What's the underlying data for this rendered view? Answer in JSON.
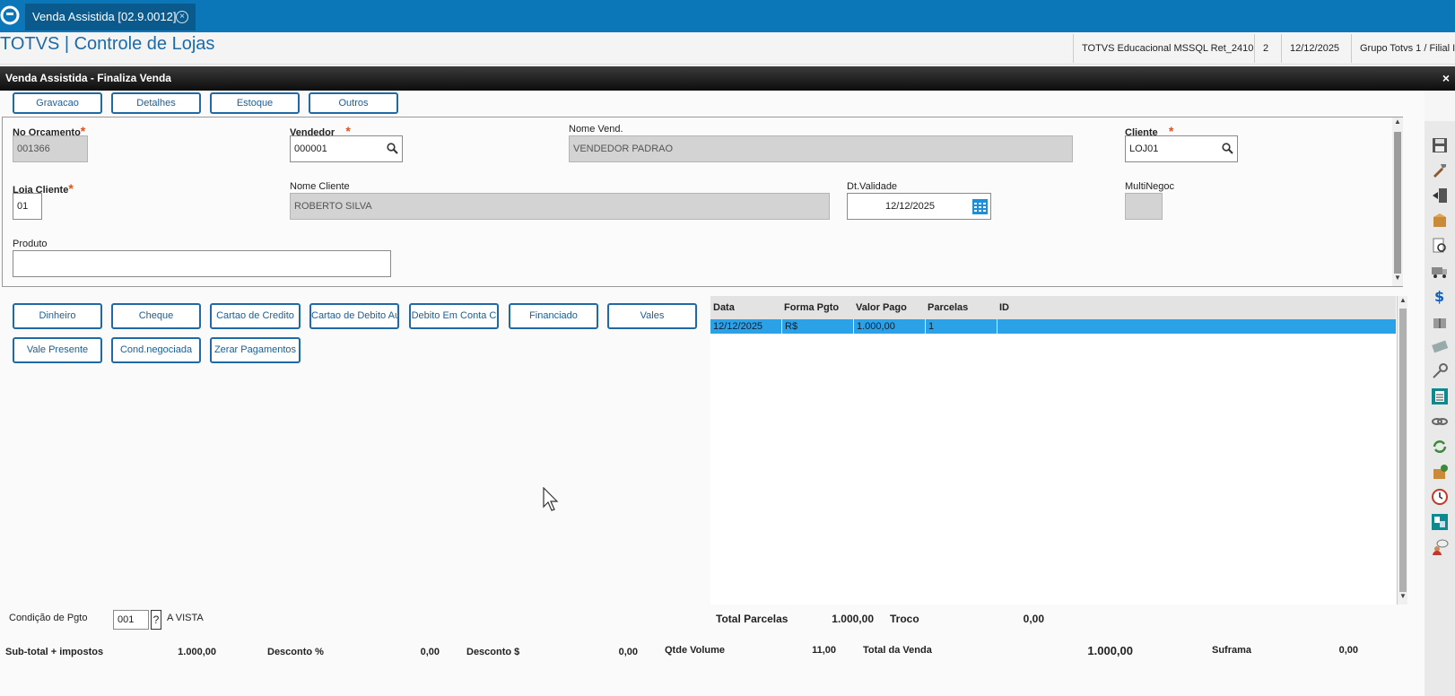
{
  "tab": {
    "title": "Venda Assistida [02.9.0012]"
  },
  "header": {
    "app_title": "TOTVS | Controle de Lojas",
    "environment": "TOTVS Educacional MSSQL Ret_2410",
    "module_number": "2",
    "date": "12/12/2025",
    "company": "Grupo Totvs 1 / Filial I"
  },
  "dialog": {
    "title": "Venda Assistida - Finaliza Venda",
    "close_label": "×"
  },
  "toolbar": [
    "Gravacao",
    "Detalhes",
    "Estoque",
    "Outros"
  ],
  "form": {
    "orcamento_label": "No Orcamento",
    "orcamento_value": "001366",
    "vendedor_label": "Vendedor",
    "vendedor_value": "000001",
    "nome_vend_label": "Nome Vend.",
    "nome_vend_value": "VENDEDOR PADRAO",
    "cliente_label": "Cliente",
    "cliente_value": "LOJ01",
    "loja_cliente_label": "Loja Cliente",
    "loja_cliente_value": "01",
    "nome_cliente_label": "Nome Cliente",
    "nome_cliente_value": "ROBERTO SILVA",
    "dt_validade_label": "Dt.Validade",
    "dt_validade_value": "12/12/2025",
    "multinegoc_label": "MultiNegoc",
    "multinegoc_value": "",
    "produto_label": "Produto",
    "produto_value": "",
    "required_mark": "*"
  },
  "payment_buttons": [
    "Dinheiro",
    "Cheque",
    "Cartao de Credito",
    "Cartao de Debito Au",
    "Debito Em Conta C",
    "Financiado",
    "Vales",
    "Vale Presente",
    "Cond.negociada",
    "Zerar Pagamentos"
  ],
  "grid": {
    "columns": [
      "Data",
      "Forma Pgto",
      "Valor Pago",
      "Parcelas",
      "ID"
    ],
    "rows": [
      {
        "data": "12/12/2025",
        "forma": "R$",
        "valor": "1.000,00",
        "parcelas": "1",
        "id": ""
      }
    ]
  },
  "condicao": {
    "label": "Condição de Pgto",
    "code": "001",
    "help": "?",
    "description": "A VISTA"
  },
  "totals": {
    "total_parcelas_label": "Total Parcelas",
    "total_parcelas_value": "1.000,00",
    "troco_label": "Troco",
    "troco_value": "0,00",
    "subtotal_label": "Sub-total + impostos",
    "subtotal_value": "1.000,00",
    "desconto_pct_label": "Desconto %",
    "desconto_pct_value": "0,00",
    "desconto_val_label": "Desconto $",
    "desconto_val_value": "0,00",
    "qtde_volume_label": "Qtde Volume",
    "qtde_volume_value": "11,00",
    "total_venda_label": "Total da Venda",
    "total_venda_value": "1.000,00",
    "suframa_label": "Suframa",
    "suframa_value": "0,00"
  },
  "right_toolbar_icons": [
    "save-icon",
    "tools-icon",
    "exit-door-icon",
    "package-icon",
    "document-search-icon",
    "truck-icon",
    "currency-exchange-icon",
    "gift-icon",
    "cash-icon",
    "key-icon",
    "checklist-icon",
    "link-chain-icon",
    "refresh-icon",
    "box-add-icon",
    "clock-icon",
    "transfer-icon",
    "user-chat-icon"
  ],
  "colors": {
    "tabbar": "#0b76b8",
    "accent": "#1f69a6",
    "selected_row": "#2ba1e8",
    "required": "#d9531e"
  }
}
